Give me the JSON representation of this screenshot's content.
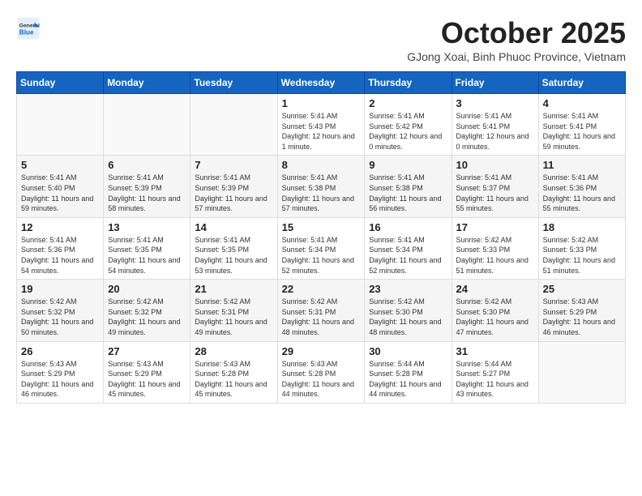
{
  "header": {
    "logo_general": "General",
    "logo_blue": "Blue",
    "month_title": "October 2025",
    "subtitle": "GJong Xoai, Binh Phuoc Province, Vietnam"
  },
  "calendar": {
    "weekdays": [
      "Sunday",
      "Monday",
      "Tuesday",
      "Wednesday",
      "Thursday",
      "Friday",
      "Saturday"
    ],
    "weeks": [
      [
        {
          "day": "",
          "info": ""
        },
        {
          "day": "",
          "info": ""
        },
        {
          "day": "",
          "info": ""
        },
        {
          "day": "1",
          "info": "Sunrise: 5:41 AM\nSunset: 5:43 PM\nDaylight: 12 hours and 1 minute."
        },
        {
          "day": "2",
          "info": "Sunrise: 5:41 AM\nSunset: 5:42 PM\nDaylight: 12 hours and 0 minutes."
        },
        {
          "day": "3",
          "info": "Sunrise: 5:41 AM\nSunset: 5:41 PM\nDaylight: 12 hours and 0 minutes."
        },
        {
          "day": "4",
          "info": "Sunrise: 5:41 AM\nSunset: 5:41 PM\nDaylight: 11 hours and 59 minutes."
        }
      ],
      [
        {
          "day": "5",
          "info": "Sunrise: 5:41 AM\nSunset: 5:40 PM\nDaylight: 11 hours and 59 minutes."
        },
        {
          "day": "6",
          "info": "Sunrise: 5:41 AM\nSunset: 5:39 PM\nDaylight: 11 hours and 58 minutes."
        },
        {
          "day": "7",
          "info": "Sunrise: 5:41 AM\nSunset: 5:39 PM\nDaylight: 11 hours and 57 minutes."
        },
        {
          "day": "8",
          "info": "Sunrise: 5:41 AM\nSunset: 5:38 PM\nDaylight: 11 hours and 57 minutes."
        },
        {
          "day": "9",
          "info": "Sunrise: 5:41 AM\nSunset: 5:38 PM\nDaylight: 11 hours and 56 minutes."
        },
        {
          "day": "10",
          "info": "Sunrise: 5:41 AM\nSunset: 5:37 PM\nDaylight: 11 hours and 55 minutes."
        },
        {
          "day": "11",
          "info": "Sunrise: 5:41 AM\nSunset: 5:36 PM\nDaylight: 11 hours and 55 minutes."
        }
      ],
      [
        {
          "day": "12",
          "info": "Sunrise: 5:41 AM\nSunset: 5:36 PM\nDaylight: 11 hours and 54 minutes."
        },
        {
          "day": "13",
          "info": "Sunrise: 5:41 AM\nSunset: 5:35 PM\nDaylight: 11 hours and 54 minutes."
        },
        {
          "day": "14",
          "info": "Sunrise: 5:41 AM\nSunset: 5:35 PM\nDaylight: 11 hours and 53 minutes."
        },
        {
          "day": "15",
          "info": "Sunrise: 5:41 AM\nSunset: 5:34 PM\nDaylight: 11 hours and 52 minutes."
        },
        {
          "day": "16",
          "info": "Sunrise: 5:41 AM\nSunset: 5:34 PM\nDaylight: 11 hours and 52 minutes."
        },
        {
          "day": "17",
          "info": "Sunrise: 5:42 AM\nSunset: 5:33 PM\nDaylight: 11 hours and 51 minutes."
        },
        {
          "day": "18",
          "info": "Sunrise: 5:42 AM\nSunset: 5:33 PM\nDaylight: 11 hours and 51 minutes."
        }
      ],
      [
        {
          "day": "19",
          "info": "Sunrise: 5:42 AM\nSunset: 5:32 PM\nDaylight: 11 hours and 50 minutes."
        },
        {
          "day": "20",
          "info": "Sunrise: 5:42 AM\nSunset: 5:32 PM\nDaylight: 11 hours and 49 minutes."
        },
        {
          "day": "21",
          "info": "Sunrise: 5:42 AM\nSunset: 5:31 PM\nDaylight: 11 hours and 49 minutes."
        },
        {
          "day": "22",
          "info": "Sunrise: 5:42 AM\nSunset: 5:31 PM\nDaylight: 11 hours and 48 minutes."
        },
        {
          "day": "23",
          "info": "Sunrise: 5:42 AM\nSunset: 5:30 PM\nDaylight: 11 hours and 48 minutes."
        },
        {
          "day": "24",
          "info": "Sunrise: 5:42 AM\nSunset: 5:30 PM\nDaylight: 11 hours and 47 minutes."
        },
        {
          "day": "25",
          "info": "Sunrise: 5:43 AM\nSunset: 5:29 PM\nDaylight: 11 hours and 46 minutes."
        }
      ],
      [
        {
          "day": "26",
          "info": "Sunrise: 5:43 AM\nSunset: 5:29 PM\nDaylight: 11 hours and 46 minutes."
        },
        {
          "day": "27",
          "info": "Sunrise: 5:43 AM\nSunset: 5:29 PM\nDaylight: 11 hours and 45 minutes."
        },
        {
          "day": "28",
          "info": "Sunrise: 5:43 AM\nSunset: 5:28 PM\nDaylight: 11 hours and 45 minutes."
        },
        {
          "day": "29",
          "info": "Sunrise: 5:43 AM\nSunset: 5:28 PM\nDaylight: 11 hours and 44 minutes."
        },
        {
          "day": "30",
          "info": "Sunrise: 5:44 AM\nSunset: 5:28 PM\nDaylight: 11 hours and 44 minutes."
        },
        {
          "day": "31",
          "info": "Sunrise: 5:44 AM\nSunset: 5:27 PM\nDaylight: 11 hours and 43 minutes."
        },
        {
          "day": "",
          "info": ""
        }
      ]
    ]
  }
}
